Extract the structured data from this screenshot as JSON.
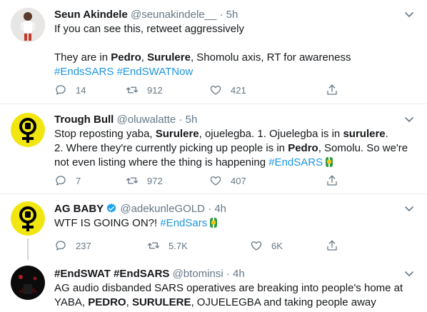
{
  "tweets": [
    {
      "name": "Seun Akindele",
      "handle": "@seunakindele__",
      "time": "5h",
      "line1": "If you can see this, retweet aggressively",
      "line2_a": "They are in ",
      "line2_b": "Pedro",
      "line2_c": ", ",
      "line2_d": "Surulere",
      "line2_e": ", Shomolu axis, RT for awareness",
      "tag1": "#EndsSARS",
      "tag2": "#EndSWATNow",
      "replies": "14",
      "retweets": "912",
      "likes": "421"
    },
    {
      "name": "Trough Bull",
      "handle": "@oluwalatte",
      "time": "5h",
      "l1_a": "Stop reposting yaba, ",
      "l1_b": "Surulere",
      "l1_c": ", ojuelegba. 1. Ojuelegba is in ",
      "l1_d": "surulere",
      "l1_e": ".",
      "l2_a": "2. Where they're currently picking up people is in ",
      "l2_b": "Pedro",
      "l2_c": ", Somolu. So we're",
      "l3_a": "not even listing where the thing is happening ",
      "l3_tag": "#EndSARS",
      "replies": "7",
      "retweets": "972",
      "likes": "407"
    },
    {
      "name": "AG BABY",
      "handle": "@adekunleGOLD",
      "time": "4h",
      "text": "WTF IS GOING ON?! ",
      "tag": "#EndSars",
      "replies": "237",
      "retweets": "5.7K",
      "likes": "6K"
    },
    {
      "name": "#EndSWAT #EndSARS",
      "handle": "@btominsi",
      "time": "4h",
      "l1": "AG audio disbanded SARS operatives are breaking into people's home at",
      "l2_a": "YABA, ",
      "l2_b": "PEDRO",
      "l2_c": ", ",
      "l2_d": "SURULERE",
      "l2_e": ", OJUELEGBA and taking people away"
    }
  ],
  "separator": "·",
  "colors": {
    "link": "#1b95e0",
    "muted": "#657786",
    "fist_green": "#2e9b3f",
    "fist_yellow": "#f5c518"
  }
}
